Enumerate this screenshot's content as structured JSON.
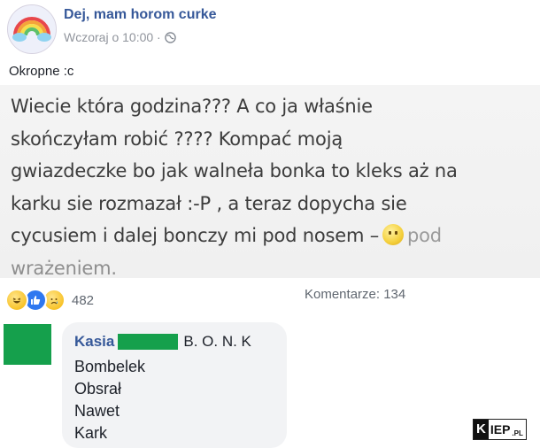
{
  "post": {
    "page_name": "Dej, mam horom curke",
    "timestamp": "Wczoraj o 10:00 ·",
    "privacy_icon": "globe-icon",
    "text": "Okropne :c"
  },
  "image": {
    "lines": [
      "Wiecie która godzina??? A co ja właśnie",
      "skończyłam robić ???? Kompać moją",
      "gwiazdeczke bo jak walneła bonka to kleks aż na",
      "karku sie rozmazał :-P , a teraz dopycha sie"
    ],
    "line5_before": "cycusiem i dalej bonczy mi pod nosem –",
    "line5_after": "pod",
    "line6": "wrażeniem."
  },
  "stats": {
    "reaction_icons": [
      "haha-icon",
      "like-icon",
      "sad-icon"
    ],
    "reaction_count": "482",
    "comments_label": "Komentarze: 134"
  },
  "comment": {
    "author": "Kasia",
    "first_line": "B. O. N. K",
    "lines": [
      "Bombelek",
      "Obsrał",
      "Nawet",
      "Kark"
    ]
  },
  "watermark": {
    "k": "K",
    "rest": "IEP",
    "suffix": ".PL"
  },
  "colors": {
    "link": "#365899",
    "redaction": "#15a04c",
    "meta": "#90949c",
    "bubble": "#f2f3f5"
  }
}
